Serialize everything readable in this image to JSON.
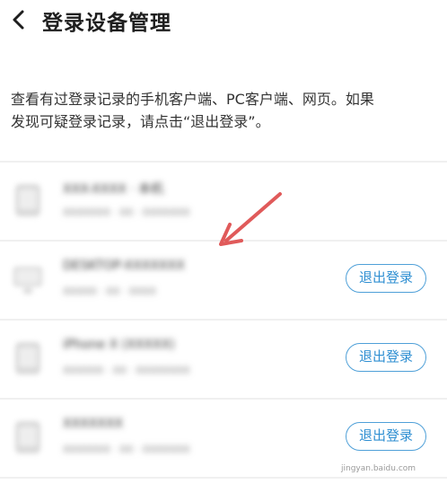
{
  "header": {
    "title": "登录设备管理"
  },
  "description": {
    "line1": "查看有过登录记录的手机客户端、PC客户端、网页。如果",
    "line2": "发现可疑登录记录，请点击“退出登录”。"
  },
  "devices": [
    {
      "name": "XXX-XXXX · 本机",
      "meta": "XXXXXXX · XX · XXXXXXX",
      "logout_label": ""
    },
    {
      "name": "DESKTOP-XXXXXXX",
      "meta": "XXXXX · XX · XXXX",
      "logout_label": "退出登录"
    },
    {
      "name": "iPhone X (XXXXX)",
      "meta": "XXXXXX · XX · XXXXXXXX",
      "logout_label": "退出登录"
    },
    {
      "name": "XXXXXXX",
      "meta": "XXXXXXX · XX · XXXXXXX",
      "logout_label": "退出登录"
    }
  ],
  "watermark": "jingyan.baidu.com",
  "colors": {
    "accent": "#2f8fd2",
    "annotation_arrow": "#e05a5a"
  },
  "icons": {
    "back": "chevron-left-icon",
    "device": "device-icon",
    "annotation": "red-arrow-annotation"
  }
}
